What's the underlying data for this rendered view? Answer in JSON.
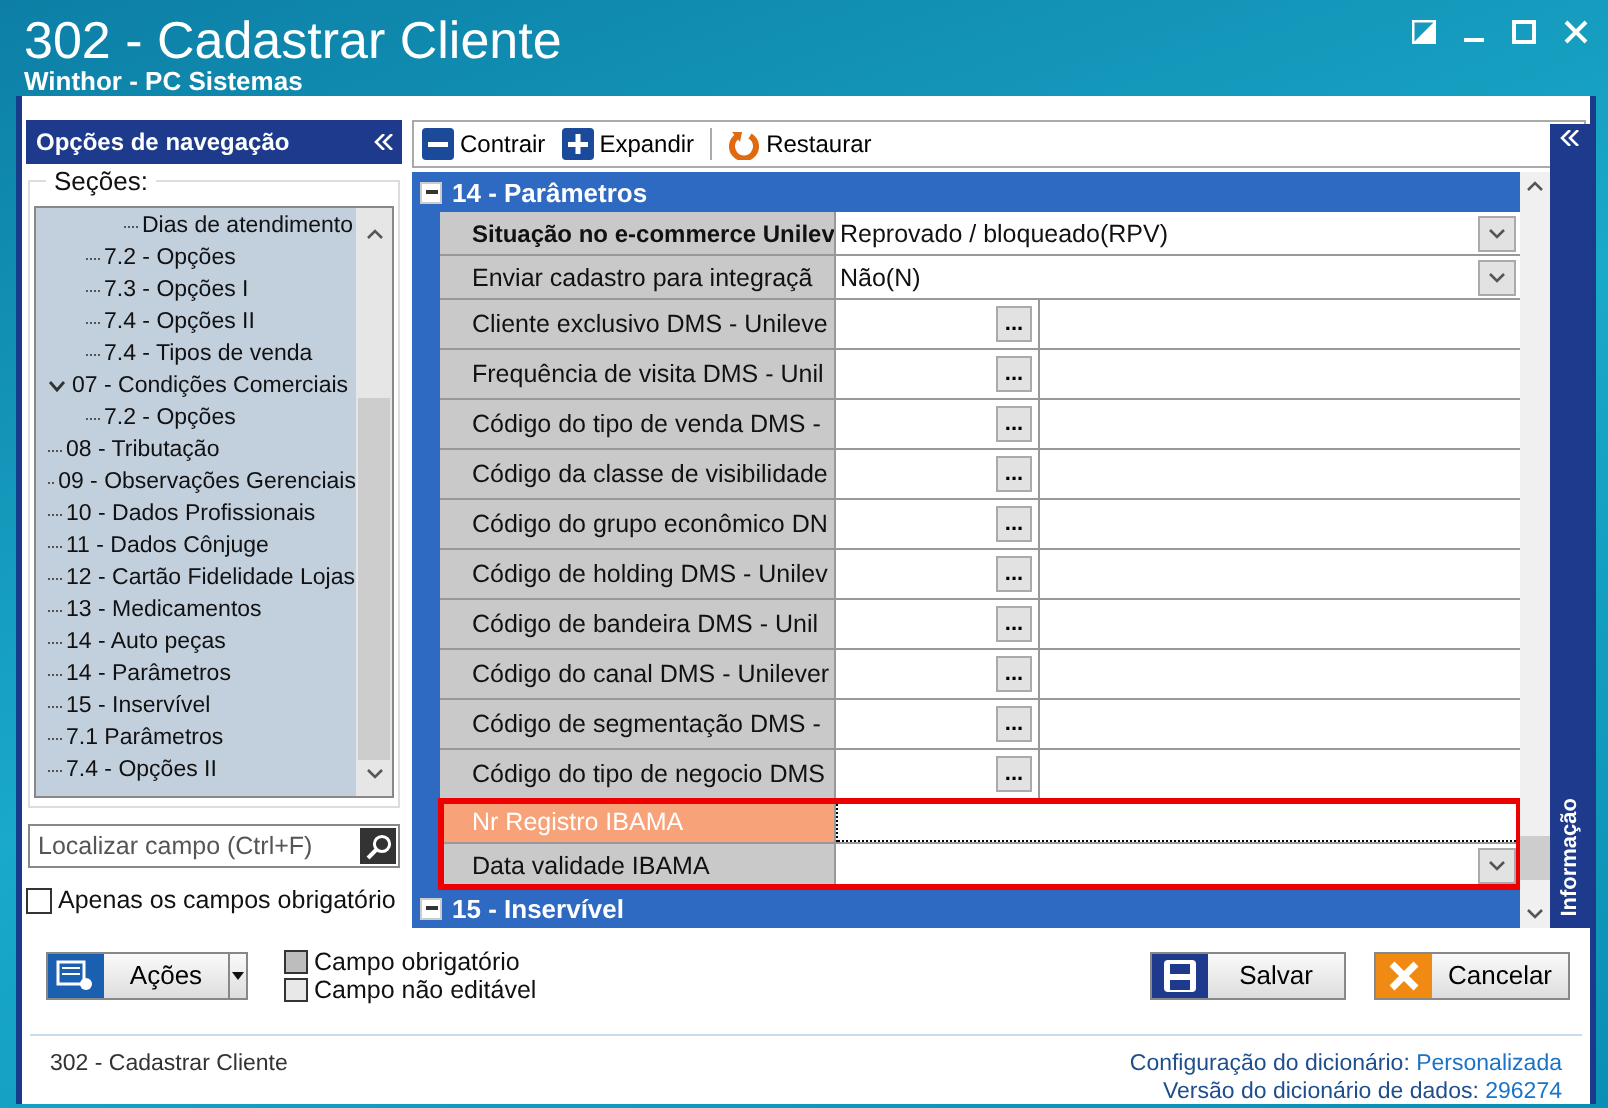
{
  "window": {
    "title": "302 - Cadastrar Cliente",
    "subtitle": "Winthor - PC Sistemas"
  },
  "navigation": {
    "title": "Opções de navegação",
    "sections_label": "Seções:",
    "tree": [
      {
        "children": [
          {
            "children": [
              {
                "label": "Dias de atendimento"
              }
            ]
          },
          {
            "label": "7.2 - Opções"
          },
          {
            "label": "7.3 - Opções I"
          },
          {
            "label": "7.4 - Opções II"
          },
          {
            "label": "7.4 - Tipos de venda"
          }
        ]
      },
      {
        "label": "07 - Condições Comerciais",
        "expanded": true,
        "children": [
          {
            "label": "7.2 - Opções"
          }
        ]
      },
      {
        "label": "08 - Tributação"
      },
      {
        "label": "09 - Observações Gerenciais"
      },
      {
        "label": "10 - Dados Profissionais"
      },
      {
        "label": "11 - Dados Cônjuge"
      },
      {
        "label": "12 - Cartão Fidelidade Lojas"
      },
      {
        "label": "13 - Medicamentos"
      },
      {
        "label": "14 - Auto peças"
      },
      {
        "label": "14 - Parâmetros"
      },
      {
        "label": "15 - Inservível"
      },
      {
        "label": "7.1 Parâmetros"
      },
      {
        "label": "7.4 - Opções II"
      }
    ],
    "search": {
      "placeholder": "Localizar campo (Ctrl+F)"
    },
    "required_only": {
      "label": "Apenas os campos obrigatório",
      "checked": false
    }
  },
  "toolbar": [
    {
      "kind": "collapse",
      "label": "Contrair"
    },
    {
      "kind": "expand",
      "label": "Expandir"
    },
    {
      "kind": "restore",
      "label": "Restaurar"
    }
  ],
  "sections": [
    {
      "title": "14 - Parâmetros",
      "fields": [
        {
          "label": "Situação no e-commerce Unilev",
          "kind": "dropdown",
          "value": "Reprovado / bloqueado(RPV)",
          "required": true,
          "selected": false,
          "highlighted": false
        },
        {
          "label": "Enviar cadastro para integraçã",
          "kind": "dropdown",
          "value": "Não(N)",
          "required": false,
          "selected": false,
          "highlighted": false
        },
        {
          "label": "Cliente exclusivo DMS - Unileve",
          "kind": "lookup",
          "button_label": "...",
          "required": false,
          "selected": false,
          "highlighted": false
        },
        {
          "label": "Frequência de visita DMS - Unil",
          "kind": "lookup",
          "button_label": "...",
          "required": false,
          "selected": false,
          "highlighted": false
        },
        {
          "label": "Código do tipo de venda DMS -",
          "kind": "lookup",
          "button_label": "...",
          "required": false,
          "selected": false,
          "highlighted": false
        },
        {
          "label": "Código da classe de visibilidade",
          "kind": "lookup",
          "button_label": "...",
          "required": false,
          "selected": false,
          "highlighted": false
        },
        {
          "label": "Código do grupo econômico DN",
          "kind": "lookup",
          "button_label": "...",
          "required": false,
          "selected": false,
          "highlighted": false
        },
        {
          "label": "Código de holding DMS - Unilev",
          "kind": "lookup",
          "button_label": "...",
          "required": false,
          "selected": false,
          "highlighted": false
        },
        {
          "label": "Código de bandeira DMS - Unil",
          "kind": "lookup",
          "button_label": "...",
          "required": false,
          "selected": false,
          "highlighted": false
        },
        {
          "label": "Código do canal DMS - Unilever",
          "kind": "lookup",
          "button_label": "...",
          "required": false,
          "selected": false,
          "highlighted": false
        },
        {
          "label": "Código de segmentação DMS -",
          "kind": "lookup",
          "button_label": "...",
          "required": false,
          "selected": false,
          "highlighted": false
        },
        {
          "label": "Código do tipo de negocio DMS",
          "kind": "lookup",
          "button_label": "...",
          "required": false,
          "selected": false,
          "highlighted": false
        },
        {
          "label": "Nr Registro IBAMA",
          "kind": "text",
          "required": false,
          "selected": true,
          "highlighted": true
        },
        {
          "label": "Data validade IBAMA",
          "kind": "dropdown",
          "required": false,
          "selected": false,
          "highlighted": true
        }
      ]
    },
    {
      "title": "15 - Inservível"
    }
  ],
  "info_panel": {
    "title": "Informação"
  },
  "actions": {
    "label": "Ações"
  },
  "legend": [
    {
      "kind": "required",
      "label": "Campo obrigatório"
    },
    {
      "kind": "readonly",
      "label": "Campo não editável"
    }
  ],
  "buttons": [
    {
      "kind": "save",
      "label": "Salvar"
    },
    {
      "kind": "cancel",
      "label": "Cancelar"
    }
  ],
  "status_bar": {
    "screen": "302 - Cadastrar Cliente",
    "config_label": "Configuração do dicionário:",
    "config_value": "Personalizada",
    "version_label": "Versão do dicionário de dados:",
    "version_value": "296274"
  }
}
